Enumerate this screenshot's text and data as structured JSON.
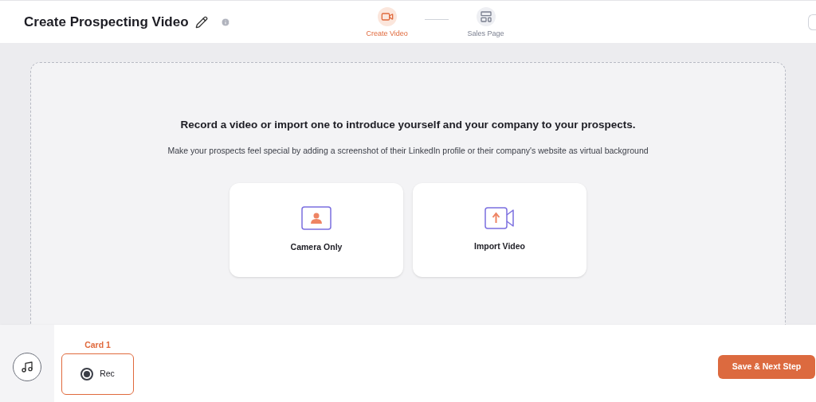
{
  "header": {
    "title": "Create Prospecting Video"
  },
  "steps": [
    {
      "label": "Create Video",
      "kind": "video",
      "selected": true
    },
    {
      "label": "Sales Page",
      "kind": "layout",
      "selected": false
    }
  ],
  "intro": {
    "heading": "Record a video or import one to introduce yourself and your company to your prospects.",
    "subtext": "Make your prospects feel special by adding a screenshot of their LinkedIn profile or their company's website as virtual background"
  },
  "options": [
    {
      "label": "Camera Only",
      "kind": "camera"
    },
    {
      "label": "Import Video",
      "kind": "import"
    }
  ],
  "cards": [
    {
      "title": "Card 1",
      "label": "Rec",
      "selected": true
    }
  ],
  "footer": {
    "button": "Save & Next Step"
  }
}
